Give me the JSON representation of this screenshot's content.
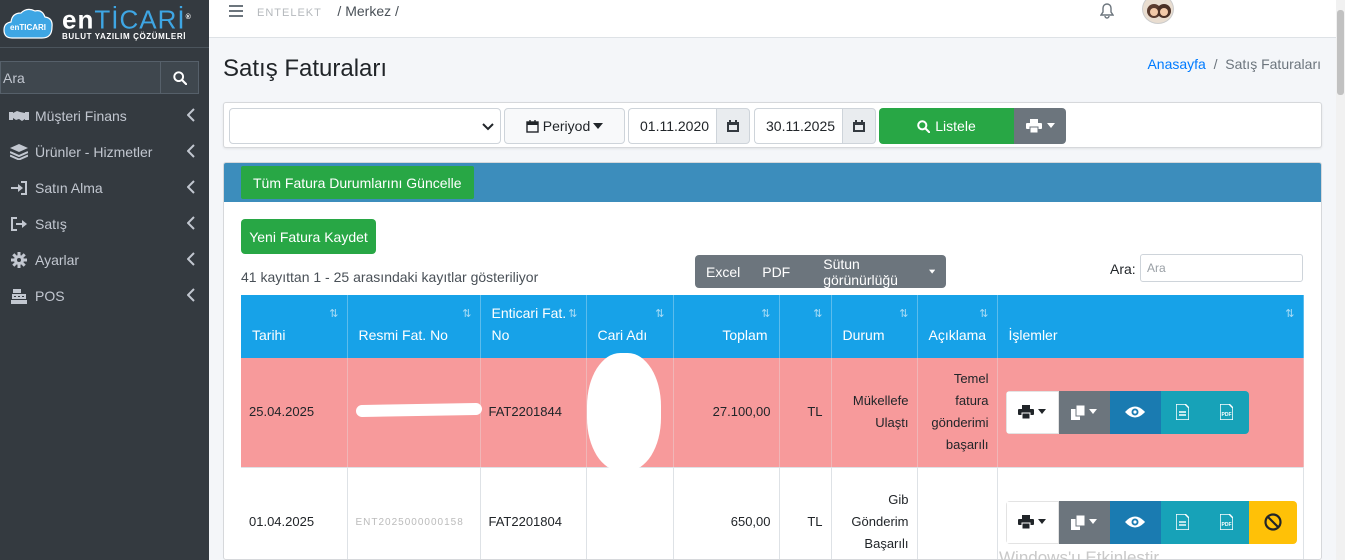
{
  "brand": {
    "cloud_text": "enTICARI",
    "main_en": "en",
    "main_ticari": "TİCARİ",
    "subtitle": "BULUT YAZILIM ÇÖZÜMLERİ",
    "reg": "®"
  },
  "sidebar": {
    "search_placeholder": "Ara",
    "items": [
      {
        "label": "Müşteri Finans",
        "icon": "handshake-icon"
      },
      {
        "label": "Ürünler - Hizmetler",
        "icon": "layers-icon"
      },
      {
        "label": "Satın Alma",
        "icon": "sign-in-icon"
      },
      {
        "label": "Satış",
        "icon": "sign-out-icon"
      },
      {
        "label": "Ayarlar",
        "icon": "gear-icon"
      },
      {
        "label": "POS",
        "icon": "cash-register-icon"
      }
    ]
  },
  "topbar": {
    "crumb_blurred": "ENTELEKT",
    "crumb_sep1": "/",
    "crumb_branch": "Merkez",
    "crumb_sep2": "/"
  },
  "page": {
    "title": "Satış Faturaları",
    "breadcrumb_home": "Anasayfa",
    "breadcrumb_sep": "/",
    "breadcrumb_current": "Satış Faturaları"
  },
  "filters": {
    "select_value": "",
    "periyod_label": "Periyod",
    "date_start": "01.11.2020",
    "date_end": "30.11.2025",
    "list_label": "Listele"
  },
  "card": {
    "update_all_label": "Tüm Fatura Durumlarını Güncelle",
    "new_invoice_label": "Yeni Fatura Kaydet",
    "info": "41 kayıttan 1 - 25 arasındaki kayıtlar gösteriliyor",
    "export_excel": "Excel",
    "export_pdf": "PDF",
    "column_visibility": "Sütun görünürlüğü",
    "search_label": "Ara:",
    "search_placeholder": "Ara"
  },
  "table": {
    "headers": [
      "Tarihi",
      "Resmi Fat. No",
      "Enticari Fat. No",
      "Cari Adı",
      "Toplam",
      "",
      "Durum",
      "Açıklama",
      "İşlemler"
    ],
    "rows": [
      {
        "date": "25.04.2025",
        "official_no": "",
        "enticari_no": "FAT2201844",
        "customer": "",
        "total": "27.100,00",
        "currency": "TL",
        "status": "Mükellefe Ulaştı",
        "description": "Temel fatura gönderimi başarılı",
        "style": "red"
      },
      {
        "date": "01.04.2025",
        "official_no": "ENT2025000000158",
        "enticari_no": "FAT2201804",
        "customer": "",
        "total": "650,00",
        "currency": "TL",
        "status": "Gib Gönderim Başarılı",
        "description": "",
        "style": "white"
      }
    ]
  },
  "watermark": "Windows'u Etkinleştir",
  "colors": {
    "sidebar": "#343a40",
    "header_blue": "#17a2e8",
    "card_header": "#3c8dbc",
    "success": "#28a745",
    "row_error": "#f79a9b"
  }
}
